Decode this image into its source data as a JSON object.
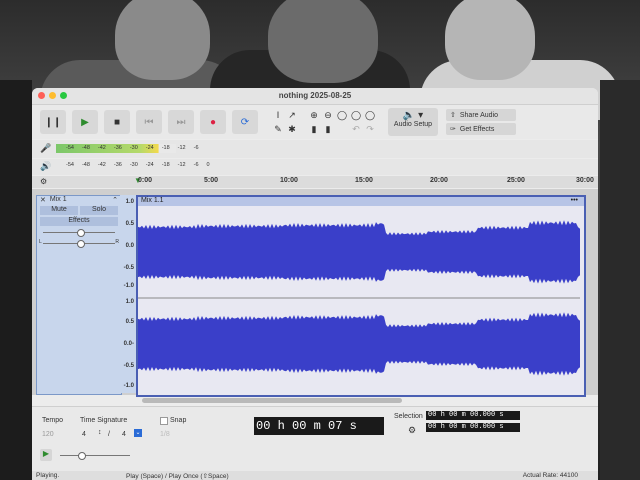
{
  "window": {
    "title": "nothing 2025-08-25"
  },
  "transport": {
    "pause_icon": "pause-icon",
    "play_icon": "play-icon",
    "stop_icon": "stop-icon",
    "skip_start_icon": "skip-start-icon",
    "skip_end_icon": "skip-end-icon",
    "record_icon": "record-icon",
    "loop_icon": "loop-icon"
  },
  "toolbar": {
    "audio_setup_label": "Audio Setup",
    "share_audio_label": "Share Audio",
    "get_effects_label": "Get Effects"
  },
  "meters": {
    "record_scale": [
      "-54",
      "-48",
      "-42",
      "-36",
      "-30",
      "-24",
      "-18",
      "-12",
      "-6"
    ],
    "play_scale": [
      "-54",
      "-48",
      "-42",
      "-36",
      "-30",
      "-24",
      "-18",
      "-12",
      "-6",
      "0"
    ]
  },
  "timeline": {
    "ticks": [
      "0:00",
      "5:00",
      "10:00",
      "15:00",
      "20:00",
      "25:00",
      "30:00"
    ]
  },
  "track": {
    "name": "Mix 1",
    "mute_label": "Mute",
    "solo_label": "Solo",
    "effects_label": "Effects",
    "pan_left": "L",
    "pan_right": "R",
    "clip_name": "Mix 1.1",
    "clip_menu": "•••",
    "vscale": [
      "1.0",
      "0.5",
      "0.0",
      "-0.5",
      "-1.0",
      "1.0",
      "0.5",
      "0.0-",
      "-0.5",
      "-1.0"
    ],
    "waveform_color": "#3a3fc9"
  },
  "bottom": {
    "tempo_label": "Tempo",
    "tempo_value": "120",
    "time_signature_label": "Time Signature",
    "ts_num": "4",
    "ts_den": "4",
    "snap_label": "Snap",
    "snap_value": "1/8",
    "time_display": "00 h 00 m 07 s",
    "selection_label": "Selection",
    "selection_start": "00 h 00 m 00.000 s",
    "selection_end": "00 h 00 m 00.000 s"
  },
  "status": {
    "state": "Playing.",
    "hint": "Play (Space) / Play Once (⇧Space)",
    "rate": "Actual Rate: 44100"
  }
}
